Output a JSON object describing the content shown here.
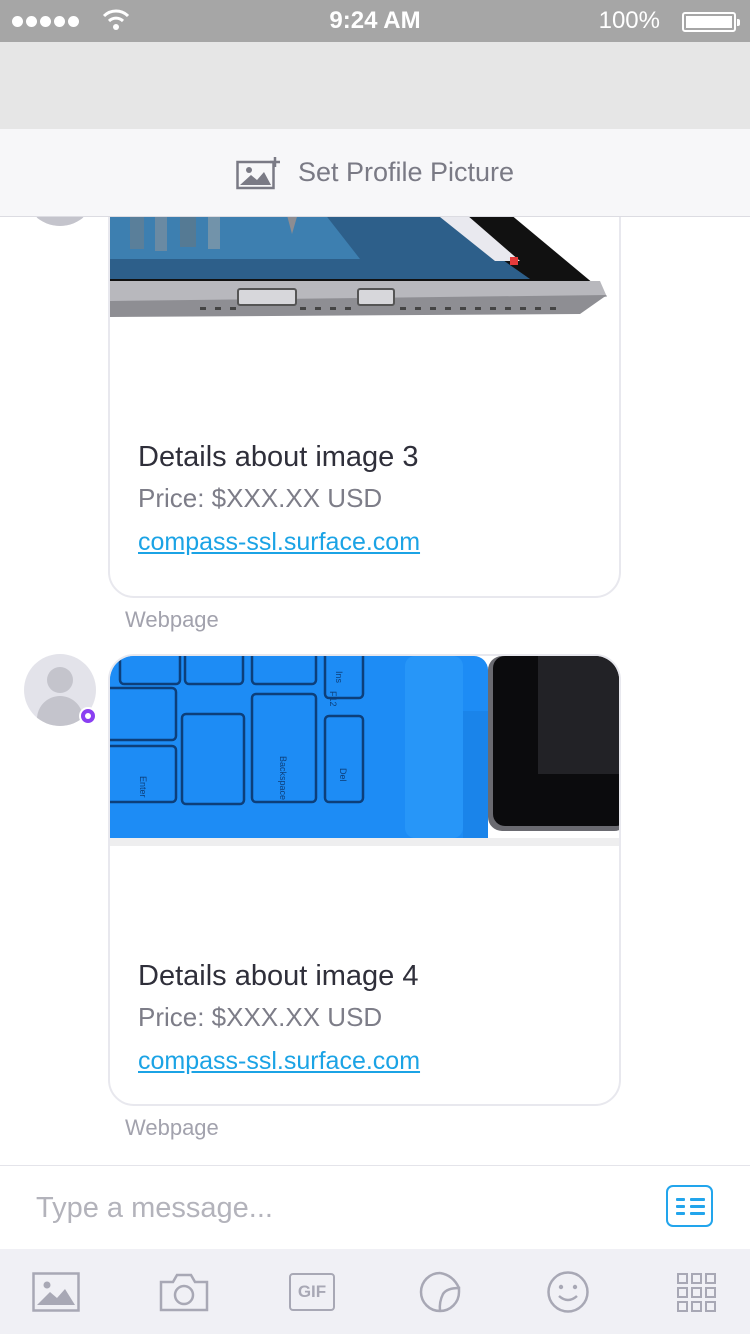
{
  "status_bar": {
    "time": "9:24 AM",
    "battery_percent": "100%",
    "signal_bars": 5,
    "icons": [
      "signal-dots-icon",
      "wifi-icon",
      "battery-icon"
    ]
  },
  "profile_bar": {
    "label": "Set Profile Picture",
    "icon": "add-image-icon"
  },
  "messages": [
    {
      "title": "Details about image 3",
      "price": "Price: $XXX.XX USD",
      "link": "compass-ssl.surface.com",
      "caption": "Webpage"
    },
    {
      "title": "Details about image 4",
      "price": "Price: $XXX.XX USD",
      "link": "compass-ssl.surface.com",
      "caption": "Webpage"
    }
  ],
  "composer": {
    "placeholder": "Type a message...",
    "menu_icon": "menu-grid-icon"
  },
  "toolbar": {
    "items": [
      "image-icon",
      "camera-icon",
      "gif-icon",
      "sticker-icon",
      "emoji-icon",
      "apps-grid-icon"
    ],
    "gif_label": "GIF"
  },
  "colors": {
    "accent": "#1ba3e5",
    "status_bar_bg": "#a6a6a6",
    "nav_bg": "#e6e6e6",
    "keyboard_blue": "#1d8cf5",
    "badge": "#8a3ff2"
  }
}
